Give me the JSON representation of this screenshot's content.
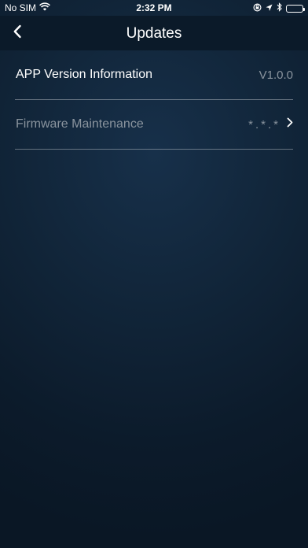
{
  "status_bar": {
    "carrier": "No SIM",
    "time": "2:32 PM",
    "icons": [
      "wifi-icon",
      "orientation-lock-icon",
      "location-icon",
      "bluetooth-icon",
      "battery-icon"
    ],
    "battery_level": 1.0
  },
  "nav": {
    "back_icon": "chevron-left-icon",
    "title": "Updates"
  },
  "rows": [
    {
      "label": "APP Version Information",
      "value": "V1.0.0"
    },
    {
      "label": "Firmware Maintenance",
      "value": "*.*.*",
      "trailing_icon": "chevron-right-icon"
    }
  ],
  "colors": {
    "background": "#112539",
    "nav_background": "#0b1a29",
    "primary_text": "#ffffff",
    "secondary_text": "#8a949e"
  }
}
